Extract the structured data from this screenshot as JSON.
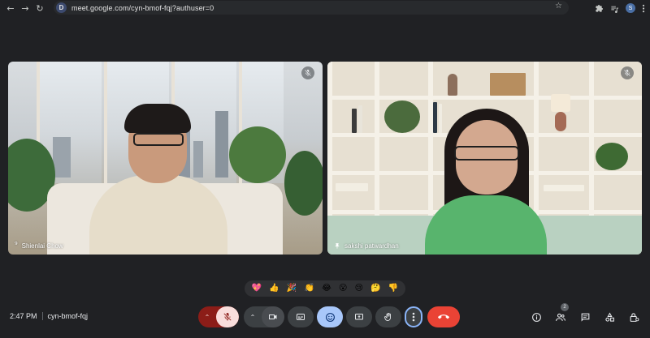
{
  "browser": {
    "site_badge": "D",
    "url": "meet.google.com/cyn-bmof-fqj?authuser=0",
    "profile_initial": "S"
  },
  "participants": [
    {
      "name": "Shienlai Chow",
      "muted": true
    },
    {
      "name": "sakshi patwardhan",
      "muted": true
    }
  ],
  "reactions": [
    "💖",
    "👍",
    "🎉",
    "👏",
    "😂",
    "😮",
    "😢",
    "🤔",
    "👎"
  ],
  "meeting": {
    "time": "2:47 PM",
    "code": "cyn-bmof-fqj"
  },
  "people_count": "2",
  "colors": {
    "background": "#202124",
    "control": "#3c4043",
    "mic_off": "#f9dedc",
    "mic_off_dark": "#8c1d18",
    "reactions_active": "#a8c7fa",
    "end_call": "#ea4335",
    "more_ring": "#8ab4f8"
  },
  "icons": {
    "mic": "mic-off-icon",
    "camera": "videocam-icon",
    "captions": "closed-caption-icon",
    "reactions": "emoji-icon",
    "present": "present-screen-icon",
    "hand": "raise-hand-icon",
    "more": "more-vert-icon",
    "end": "call-end-icon",
    "info": "info-icon",
    "people": "people-icon",
    "chat": "chat-icon",
    "activities": "activities-icon",
    "host": "host-controls-icon"
  }
}
